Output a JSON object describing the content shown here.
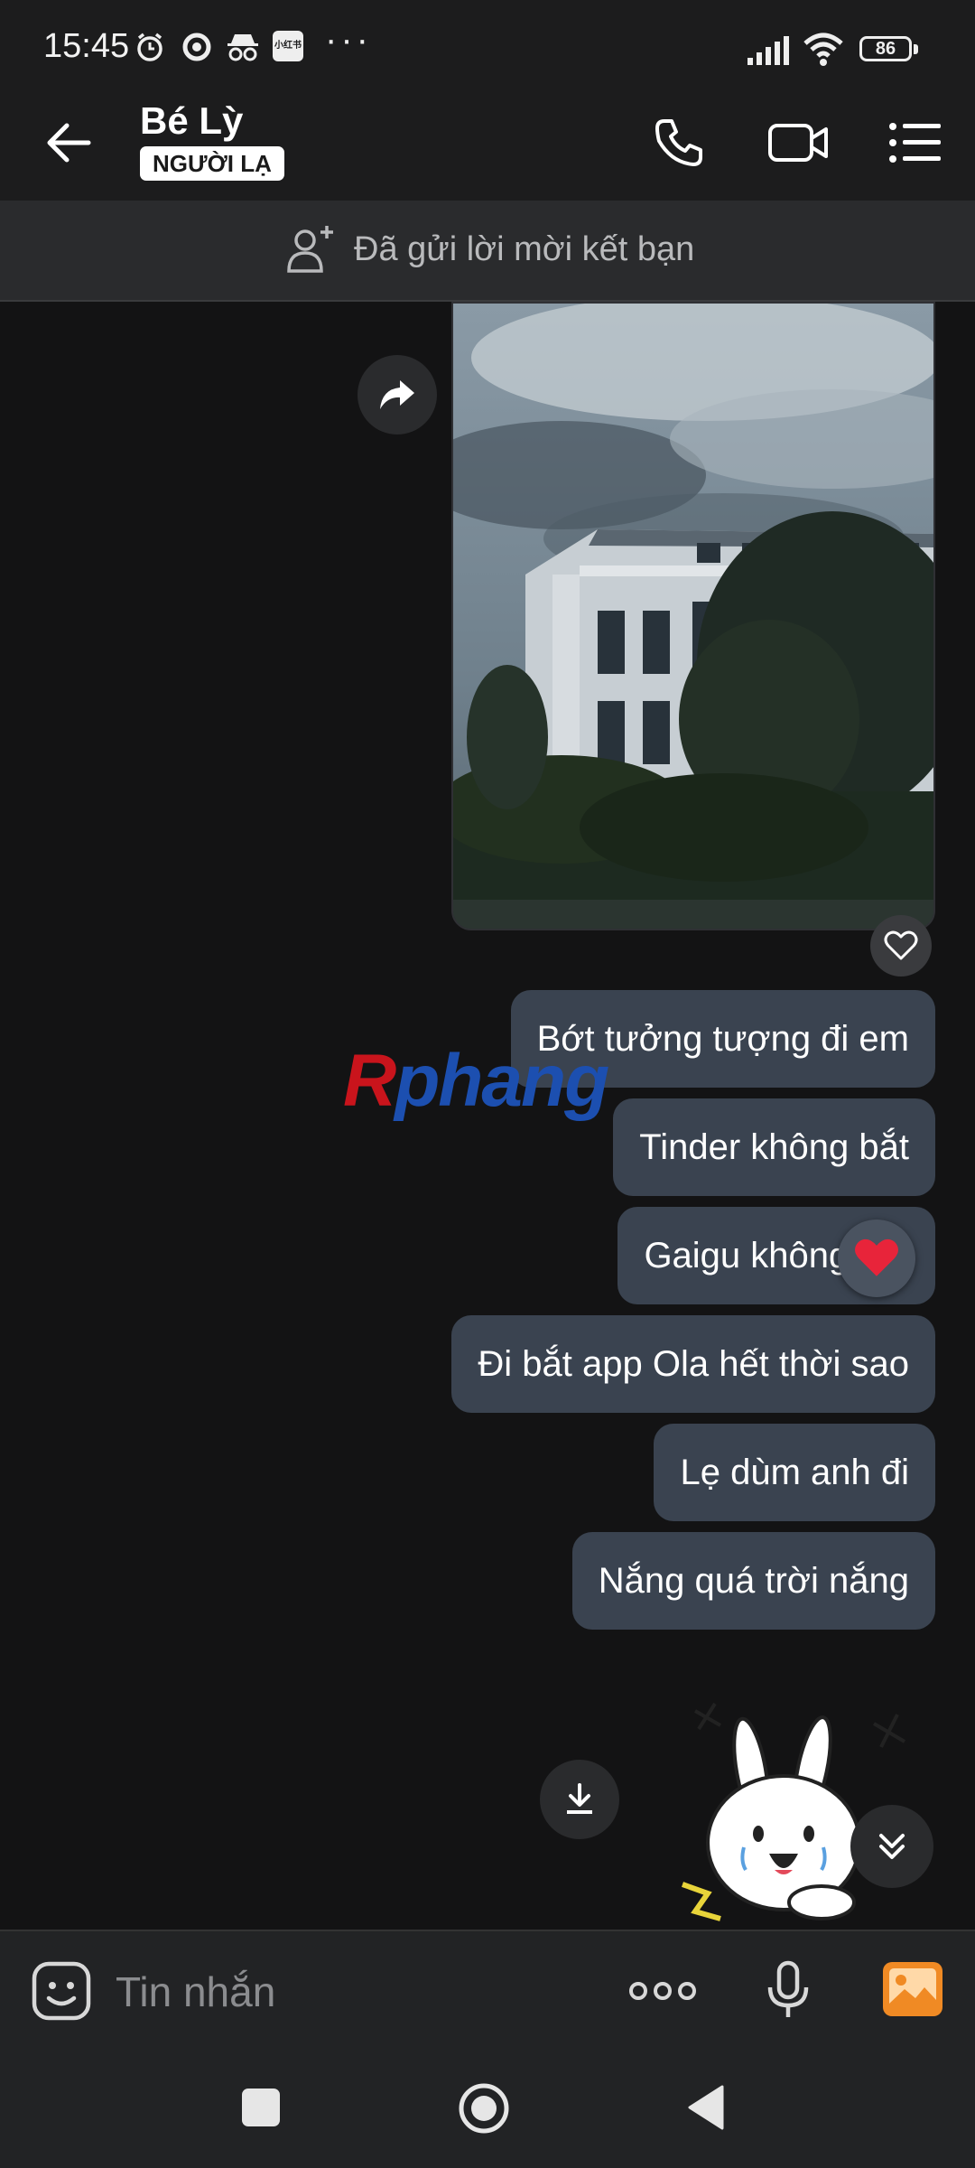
{
  "status_bar": {
    "time": "15:45",
    "app_icon_label": "小红书",
    "more": "···",
    "battery": "86"
  },
  "header": {
    "contact_name": "Bé Lỳ",
    "badge": "NGƯỜI LẠ",
    "icons": [
      "back-arrow-icon",
      "phone-icon",
      "video-camera-icon",
      "menu-list-icon"
    ]
  },
  "friend_banner": {
    "text": "Đã gửi lời mời kết bạn",
    "icon": "add-friend-icon"
  },
  "messages": [
    {
      "text": "Bớt tưởng tượng đi em"
    },
    {
      "text": "Tinder không bắt"
    },
    {
      "text": "Gaigu không bắt",
      "reaction": "heart"
    },
    {
      "text": "Đi bắt app Ola hết thời sao"
    },
    {
      "text": "Lẹ dùm anh đi"
    },
    {
      "text": "Nắng quá trời nắng"
    }
  ],
  "watermark": {
    "part1": "R",
    "part2": "phang"
  },
  "input": {
    "placeholder": "Tin nhắn",
    "icons": [
      "sticker-icon",
      "more-dots-icon",
      "microphone-icon",
      "image-gallery-icon"
    ]
  },
  "colors": {
    "bubble": "#3a4350",
    "background": "#131314",
    "header": "#1c1c1d",
    "gallery_orange": "#f08a24"
  }
}
